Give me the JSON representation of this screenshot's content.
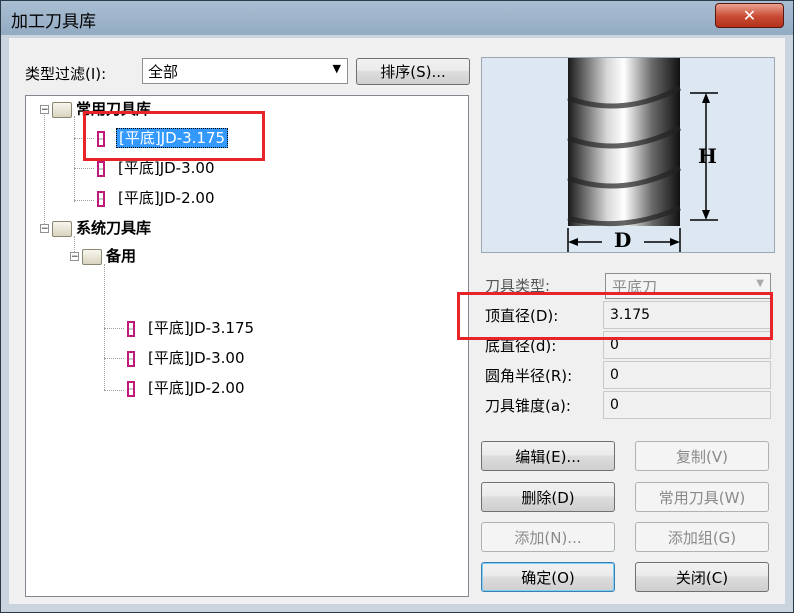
{
  "window": {
    "title": "加工刀具库",
    "close_label": "✕"
  },
  "filter": {
    "label": "类型过滤(I):",
    "value": "全部",
    "sort_button": "排序(S)..."
  },
  "tree": {
    "common_root": "常用刀具库",
    "common_items": [
      "[平底]JD-3.175",
      "[平底]JD-3.00",
      "[平底]JD-2.00"
    ],
    "system_root": "系统刀具库",
    "system_sub": "备用",
    "system_items": [
      "[平底]JD-3.175",
      "[平底]JD-3.00",
      "[平底]JD-2.00"
    ],
    "selected": "[平底]JD-3.175"
  },
  "preview": {
    "height_label": "H",
    "diameter_label": "D"
  },
  "properties": {
    "type_label": "刀具类型:",
    "type_value": "平底刀",
    "top_diameter_label": "顶直径(D):",
    "top_diameter_value": "3.175",
    "bottom_diameter_label": "底直径(d):",
    "bottom_diameter_value": "0",
    "corner_radius_label": "圆角半径(R):",
    "corner_radius_value": "0",
    "taper_label": "刀具锥度(a):",
    "taper_value": "0"
  },
  "buttons": {
    "edit": "编辑(E)...",
    "copy": "复制(V)",
    "delete": "删除(D)",
    "common_tool": "常用刀具(W)",
    "add": "添加(N)...",
    "add_group": "添加组(G)",
    "ok": "确定(O)",
    "close": "关闭(C)"
  },
  "colors": {
    "highlight": "#e8242b",
    "selection": "#3399ff"
  }
}
